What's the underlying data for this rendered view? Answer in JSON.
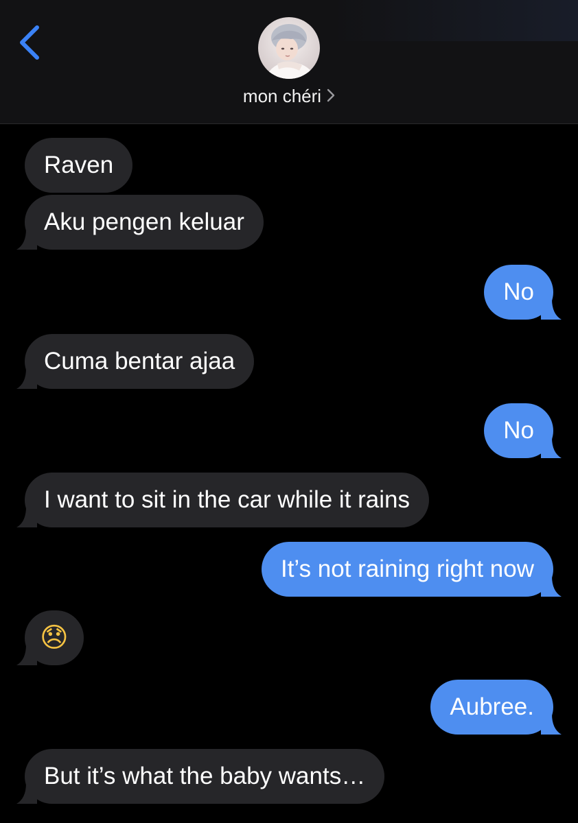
{
  "header": {
    "contact_name": "mon chéri",
    "back_icon": "chevron-left-icon",
    "avatar": "contact-avatar"
  },
  "colors": {
    "incoming_bubble": "#262629",
    "outgoing_bubble": "#4e8ef0",
    "accent": "#3b82f6",
    "background": "#000000"
  },
  "messages": [
    {
      "direction": "incoming",
      "text": "Raven"
    },
    {
      "direction": "incoming",
      "text": "Aku pengen keluar"
    },
    {
      "direction": "outgoing",
      "text": "No"
    },
    {
      "direction": "incoming",
      "text": "Cuma bentar ajaa"
    },
    {
      "direction": "outgoing",
      "text": "No"
    },
    {
      "direction": "incoming",
      "text": "I want to sit in the car while it rains"
    },
    {
      "direction": "outgoing",
      "text": "It’s not raining right now"
    },
    {
      "direction": "incoming",
      "text": "😞",
      "emoji": "disappointed-face-emoji"
    },
    {
      "direction": "outgoing",
      "text": "Aubree."
    },
    {
      "direction": "incoming",
      "text": "But it’s what the baby wants…"
    }
  ]
}
